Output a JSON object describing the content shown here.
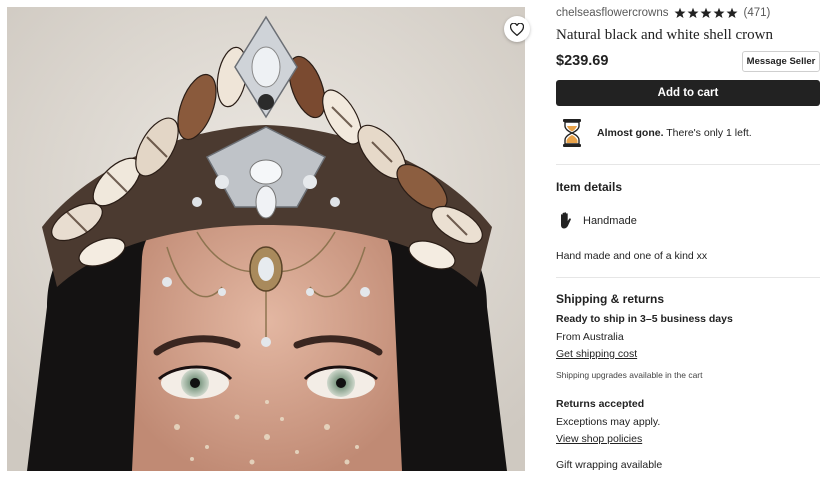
{
  "listing": {
    "shop_name": "chelseasflowercrowns",
    "rating_count": "(471)",
    "rating_stars": 5,
    "title": "Natural black and white shell crown",
    "price": "$239.69"
  },
  "buttons": {
    "message_seller": "Message Seller",
    "add_to_cart": "Add to cart"
  },
  "stock": {
    "emphasis": "Almost gone.",
    "rest": "There's only 1 left."
  },
  "item_details": {
    "heading": "Item details",
    "handmade": "Handmade",
    "description": "Hand made and one of a kind xx"
  },
  "shipping": {
    "heading": "Shipping & returns",
    "ready": "Ready to ship in 3–5 business days",
    "from": "From Australia",
    "cost_link": "Get shipping cost",
    "upgrades": "Shipping upgrades available in the cart",
    "returns_heading": "Returns accepted",
    "exceptions": "Exceptions may apply.",
    "policies_link": "View shop policies",
    "gift": "Gift wrapping available"
  },
  "colors": {
    "button_dark": "#222222",
    "star": "#222222",
    "hourglass_sand": "#e9a34a"
  },
  "icons": {
    "favorite": "heart-outline-icon",
    "stock": "hourglass-icon",
    "handmade": "hand-icon",
    "rating": "star-icon"
  }
}
